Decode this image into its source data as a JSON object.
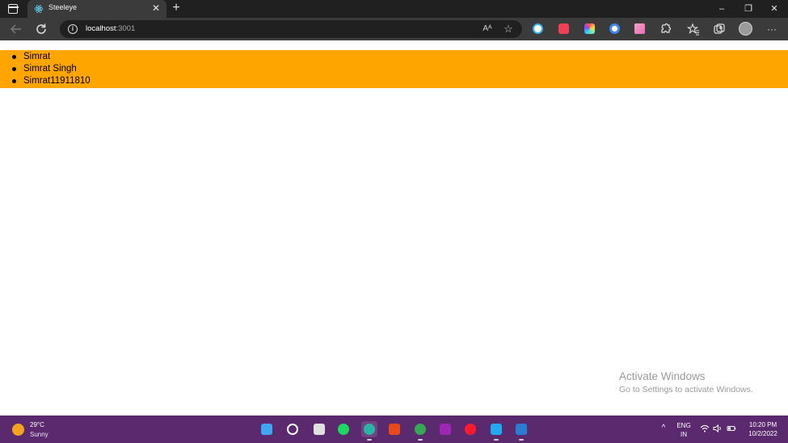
{
  "browser": {
    "tab_title": "Steeleye",
    "close_glyph": "✕",
    "new_tab_glyph": "+",
    "address": {
      "host": "localhost",
      "port": ":3001"
    },
    "read_aloud_glyph": "Aᴬ",
    "favorite_glyph": "☆",
    "more_glyph": "···",
    "window": {
      "minimize": "–",
      "restore": "❐",
      "close": "✕"
    },
    "extensions": [
      {
        "icon": "colorzilla-icon",
        "color": "#3ab0e8"
      },
      {
        "icon": "pocket-icon",
        "color": "#ef4056"
      },
      {
        "icon": "color-picker-icon",
        "color": "#7c4dff"
      },
      {
        "icon": "wappalyzer-icon",
        "color": "#4285f4"
      },
      {
        "icon": "gradient-icon",
        "color": "#e86bb7"
      },
      {
        "icon": "extensions-icon",
        "color": "#cfcfcf"
      }
    ]
  },
  "page": {
    "list_items": [
      "Simrat",
      "Simrat Singh",
      "Simrat11911810"
    ],
    "highlight_color": "#ffa500"
  },
  "watermark": {
    "title": "Activate Windows",
    "subtitle": "Go to Settings to activate Windows."
  },
  "taskbar": {
    "weather": {
      "temp": "29°C",
      "condition": "Sunny"
    },
    "apps": [
      {
        "icon": "windows-start-icon",
        "color": "#3fa7f2"
      },
      {
        "icon": "search-icon",
        "color": "#ffffff"
      },
      {
        "icon": "task-view-icon",
        "color": "#e0e0e0"
      },
      {
        "icon": "spotify-icon",
        "color": "#1ed760"
      },
      {
        "icon": "edge-icon",
        "color": "#2bb3a3"
      },
      {
        "icon": "office-icon",
        "color": "#e64a19"
      },
      {
        "icon": "chrome-icon",
        "color": "#34a853"
      },
      {
        "icon": "onenote-icon",
        "color": "#9c27b0"
      },
      {
        "icon": "opera-icon",
        "color": "#ff1b2d"
      },
      {
        "icon": "vscode-icon",
        "color": "#23a9f2"
      },
      {
        "icon": "word-icon",
        "color": "#2b7cd3"
      }
    ],
    "tray": {
      "chevron": "^",
      "lang_line1": "ENG",
      "lang_line2": "IN",
      "time": "10:20 PM",
      "date": "10/2/2022"
    }
  }
}
